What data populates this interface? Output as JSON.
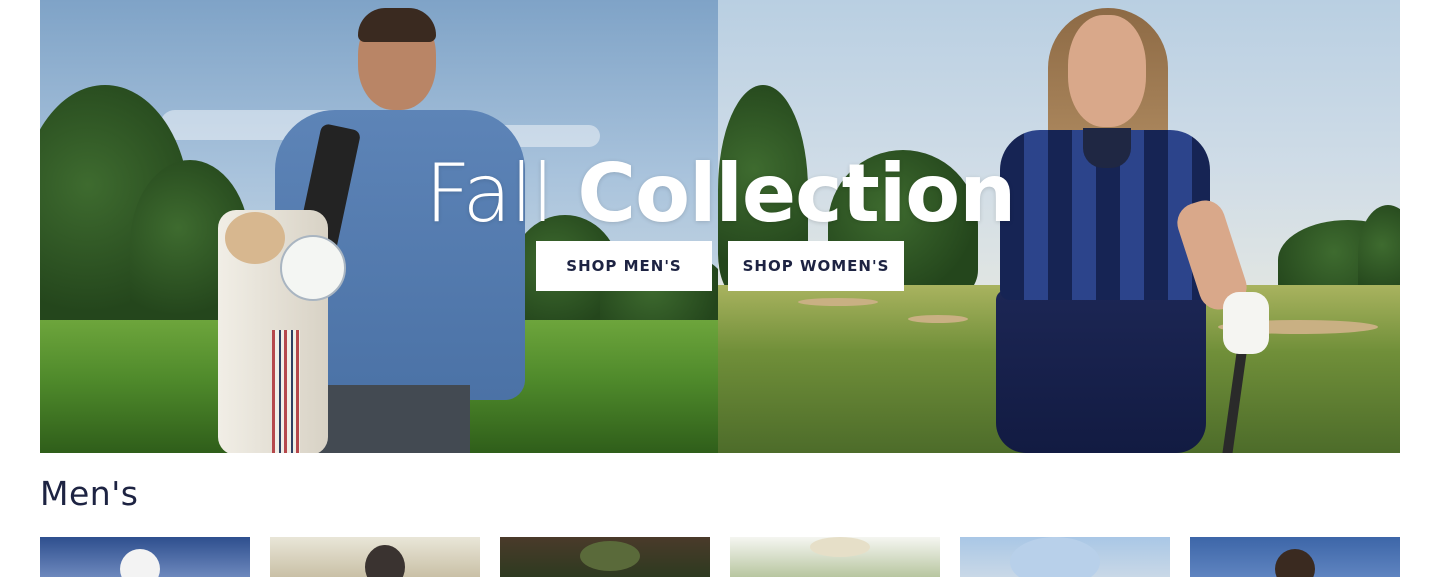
{
  "hero": {
    "title_light": "Fall",
    "title_bold": "Collection",
    "buttons": {
      "shop_mens": "SHOP MEN'S",
      "shop_womens": "SHOP WOMEN'S"
    }
  },
  "sections": {
    "mens": {
      "title": "Men's",
      "product_count_visible": 6
    }
  },
  "colors": {
    "navy_text": "#1d2342",
    "button_bg": "#ffffff",
    "page_bg": "#ffffff"
  }
}
